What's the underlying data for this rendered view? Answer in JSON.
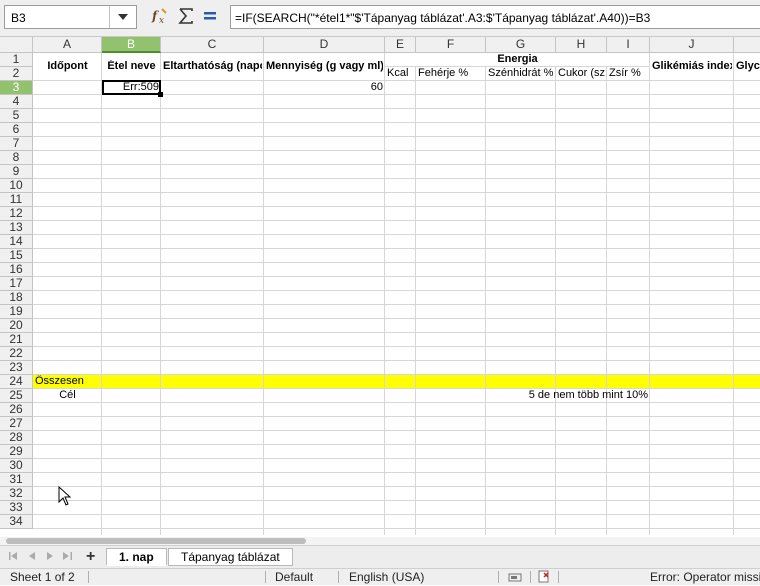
{
  "formula_bar": {
    "name_box": "B3",
    "formula": "=IF(SEARCH(\"*étel1*\"$'Tápanyag táblázat'.A3:$'Tápanyag táblázat'.A40))=B3",
    "icons": [
      "function-wizard-icon",
      "sum-icon",
      "equals-icon"
    ]
  },
  "columns": [
    "A",
    "B",
    "C",
    "D",
    "E",
    "F",
    "G",
    "H",
    "I",
    "J",
    ""
  ],
  "selected_column": "B",
  "rows": [
    "1",
    "2",
    "3",
    "4",
    "5",
    "6",
    "7",
    "8",
    "9",
    "10",
    "11",
    "12",
    "13",
    "14",
    "15",
    "16",
    "17",
    "18",
    "19",
    "20",
    "21",
    "22",
    "23",
    "24",
    "25",
    "26",
    "27",
    "28",
    "29",
    "30",
    "31",
    "32",
    "33",
    "34"
  ],
  "selected_row": "3",
  "cells": {
    "a1": "Időpont",
    "b1": "Étel neve",
    "c1": "Eltarthatóság (napok)",
    "d1": "Mennyiség (g vagy ml)",
    "e1_energy": "Energia",
    "j1": "Glikémiás index",
    "k1": "Glycemic load",
    "e2": "Kcal",
    "f2": "Fehérje %",
    "g2": "Szénhidrát %",
    "h2": "Cukor (szénhidrát)",
    "i2": "Zsír %",
    "b3": "Err:509",
    "d3": "60",
    "a24": "Összesen",
    "a25": "Cél",
    "g25": "5 de nem több mint 10%"
  },
  "colors": {
    "highlight_row": "#ffff00",
    "selected_header": "#92c26e"
  },
  "sheet_tabs": [
    {
      "label": "1. nap",
      "active": true
    },
    {
      "label": "Tápanyag táblázat",
      "active": false
    }
  ],
  "status_bar": {
    "sheet": "Sheet 1 of 2",
    "page_style": "Default",
    "language": "English (USA)",
    "error": "Error: Operator missing"
  }
}
